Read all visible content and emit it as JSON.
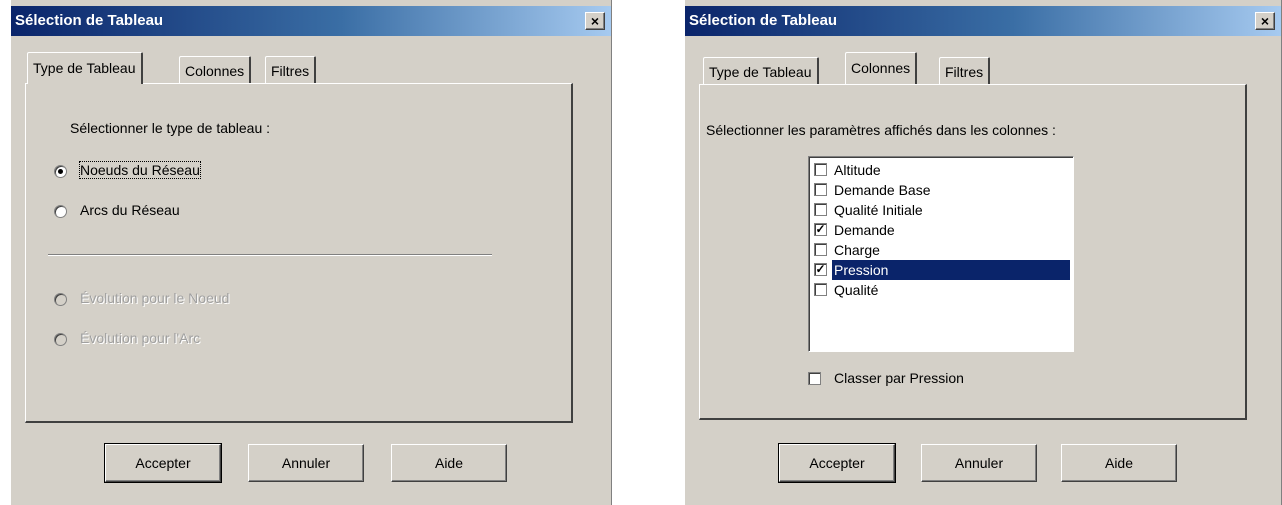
{
  "dialogs": [
    {
      "title": "Sélection de Tableau",
      "close_label": "×",
      "tabs": [
        "Type de Tableau",
        "Colonnes",
        "Filtres"
      ],
      "active_tab": "Type de Tableau",
      "prompt": "Sélectionner le type de tableau :",
      "options": [
        {
          "label": "Noeuds du Réseau",
          "checked": true,
          "enabled": true
        },
        {
          "label": "Arcs du Réseau",
          "checked": false,
          "enabled": true
        },
        {
          "label": "Évolution pour le Noeud",
          "checked": false,
          "enabled": false
        },
        {
          "label": "Évolution pour l'Arc",
          "checked": false,
          "enabled": false
        }
      ],
      "buttons": {
        "accept": "Accepter",
        "cancel": "Annuler",
        "help": "Aide"
      }
    },
    {
      "title": "Sélection de Tableau",
      "close_label": "×",
      "tabs": [
        "Type de Tableau",
        "Colonnes",
        "Filtres"
      ],
      "active_tab": "Colonnes",
      "prompt": "Sélectionner les paramètres affichés dans les colonnes :",
      "columns": [
        {
          "label": "Altitude",
          "checked": false,
          "selected": false
        },
        {
          "label": "Demande Base",
          "checked": false,
          "selected": false
        },
        {
          "label": "Qualité Initiale",
          "checked": false,
          "selected": false
        },
        {
          "label": "Demande",
          "checked": true,
          "selected": false
        },
        {
          "label": "Charge",
          "checked": false,
          "selected": false
        },
        {
          "label": "Pression",
          "checked": true,
          "selected": true
        },
        {
          "label": "Qualité",
          "checked": false,
          "selected": false
        }
      ],
      "sort_label": "Classer par Pression",
      "sort_checked": false,
      "buttons": {
        "accept": "Accepter",
        "cancel": "Annuler",
        "help": "Aide"
      }
    }
  ]
}
